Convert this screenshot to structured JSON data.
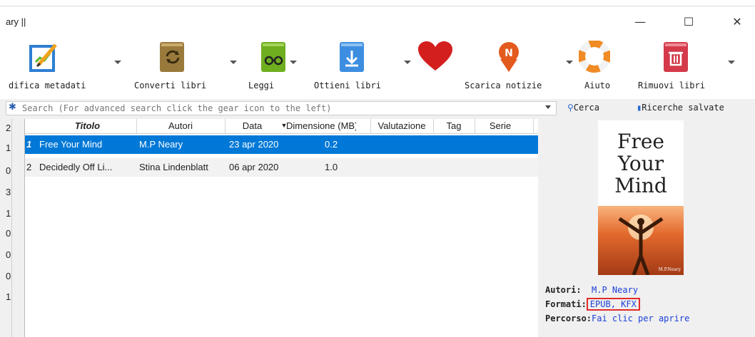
{
  "window": {
    "title": "ary ||",
    "minimize_glyph": "—",
    "maximize_glyph": "☐",
    "close_glyph": "✕"
  },
  "toolbar": {
    "edit_metadata": "difica metadati",
    "convert": "Converti libri",
    "read": "Leggi",
    "get_books": "Ottieni libri",
    "news": "Scarica notizie",
    "help": "Aiuto",
    "remove": "Rimuovi libri"
  },
  "search": {
    "placeholder": "Search (For advanced search click the gear icon to the left)",
    "search_button": "Cerca",
    "saved_searches": "Ricerche salvate"
  },
  "left_counts": [
    "2",
    "1",
    "0",
    "3",
    "1",
    "0",
    "0",
    "0",
    "1"
  ],
  "table": {
    "columns": [
      "Titolo",
      "Autori",
      "Data",
      "Dimensione (MB)",
      "Valutazione",
      "Tag",
      "Serie"
    ],
    "rows": [
      {
        "num": "1",
        "title": "Free Your Mind",
        "author": "M.P Neary",
        "date": "23 apr 2020",
        "size": "0.2"
      },
      {
        "num": "2",
        "title": "Decidedly Off Li...",
        "author": "Stina Lindenblatt",
        "date": "06 apr 2020",
        "size": "1.0"
      }
    ]
  },
  "details": {
    "cover_title": "Free Your Mind",
    "cover_author": "M.P.Neary",
    "authors_label": "Autori:",
    "authors_value": "M.P Neary",
    "formats_label": "Formati:",
    "formats_value": "EPUB, KFX",
    "path_label": "Percorso:",
    "path_value": "Fai clic per aprire"
  },
  "colors": {
    "selection": "#0078d7",
    "highlight_box": "#e02b2b",
    "link": "#1a3fd8"
  }
}
